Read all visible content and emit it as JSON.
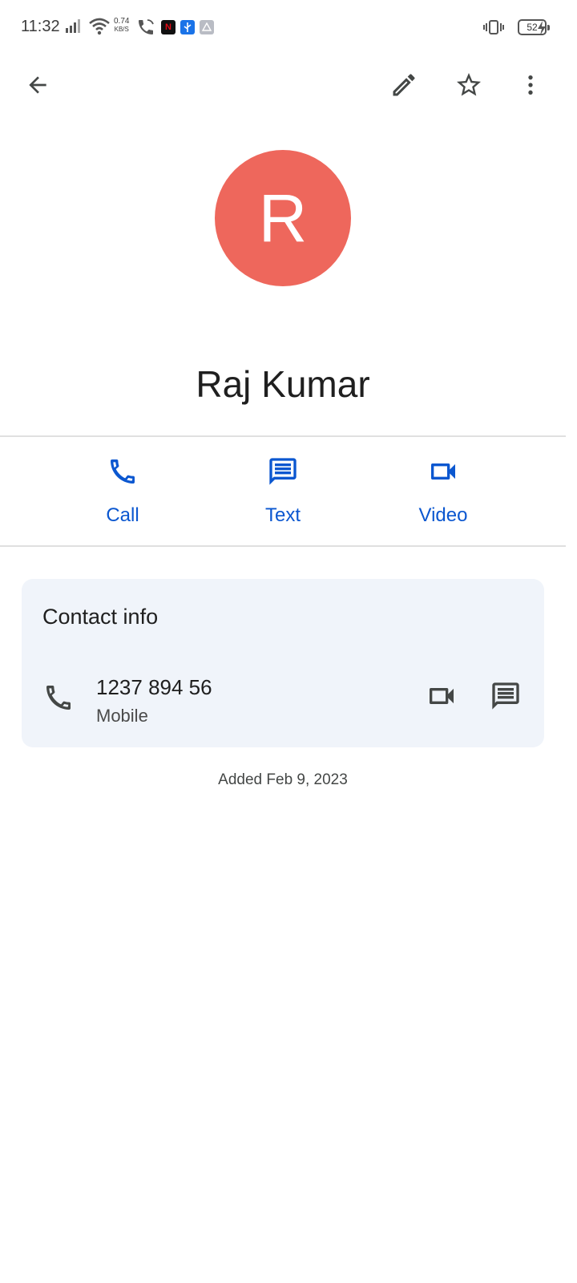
{
  "status_bar": {
    "time": "11:32",
    "speed_value": "0.74",
    "speed_unit": "KB/S",
    "battery_level": "52",
    "icons": [
      "signal-icon",
      "wifi-icon",
      "wifi-calling-icon",
      "netflix-app-icon",
      "usb-icon",
      "apps-icon",
      "vibrate-icon",
      "battery-icon",
      "charging-icon"
    ],
    "app_letter": "N"
  },
  "app_bar": {
    "icons": [
      "back-arrow-icon",
      "edit-icon",
      "star-icon",
      "more-vert-icon"
    ]
  },
  "contact": {
    "initial": "R",
    "avatar_color": "#ee675c",
    "name": "Raj Kumar"
  },
  "actions": [
    {
      "label": "Call",
      "icon": "call-icon"
    },
    {
      "label": "Text",
      "icon": "message-icon"
    },
    {
      "label": "Video",
      "icon": "videocam-icon"
    }
  ],
  "contact_info": {
    "title": "Contact info",
    "phone": {
      "number": "1237 894 56",
      "type": "Mobile"
    }
  },
  "added_text": "Added Feb 9, 2023",
  "colors": {
    "accent": "#0b57d0",
    "card_background": "#f0f4fa",
    "icon_gray": "#444746"
  }
}
